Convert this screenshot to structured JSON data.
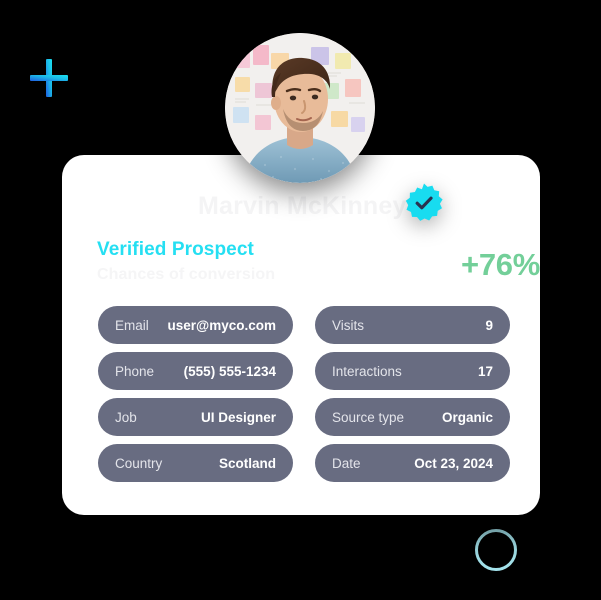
{
  "theme": {
    "background": "#000000",
    "card_background": "#ffffff",
    "accent_cyan": "#25dff2",
    "accent_green": "#73cf99",
    "pill_background": "#686c81",
    "pill_label_color": "#e3e4ea",
    "pill_value_color": "#ffffff",
    "name_color": "#f4f4f5",
    "ring_color": "#a6e6ef"
  },
  "decorations": {
    "plus_icon": "plus-icon",
    "ring_icon": "circle-outline-icon"
  },
  "profile": {
    "avatar_alt": "avatar-photo",
    "name": "Marvin McKinney",
    "badge_icon": "verified-badge-icon"
  },
  "headline": {
    "title": "Verified Prospect",
    "subtitle": "Chances of conversion",
    "percent": "+76%"
  },
  "details": {
    "left_column": [
      {
        "label": "Email",
        "value": "user@myco.com"
      },
      {
        "label": "Phone",
        "value": "(555) 555-1234"
      },
      {
        "label": "Job",
        "value": "UI Designer"
      },
      {
        "label": "Country",
        "value": "Scotland"
      }
    ],
    "right_column": [
      {
        "label": "Visits",
        "value": "9"
      },
      {
        "label": "Interactions",
        "value": "17"
      },
      {
        "label": "Source type",
        "value": "Organic"
      },
      {
        "label": "Date",
        "value": "Oct 23, 2024"
      }
    ]
  }
}
